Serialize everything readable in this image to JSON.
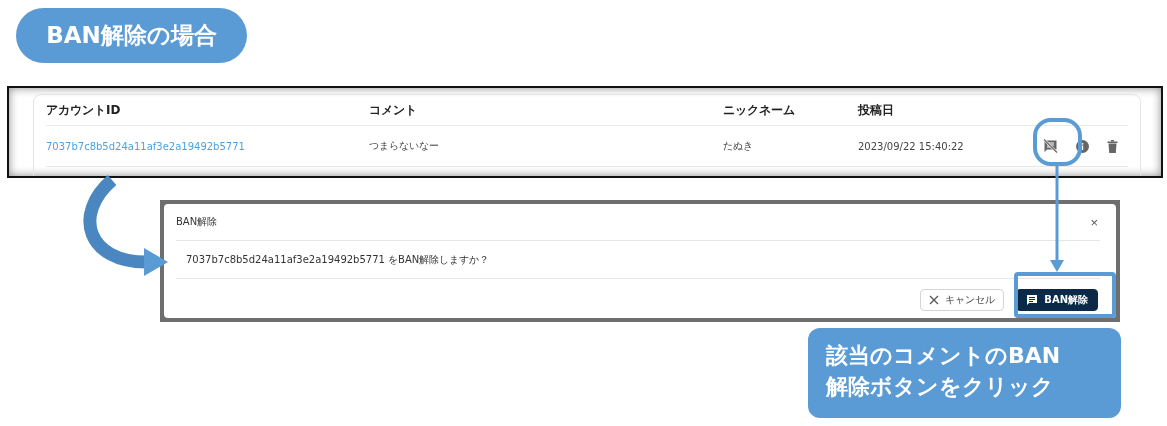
{
  "title_badge": "BAN解除の場合",
  "table": {
    "columns": [
      "アカウントID",
      "コメント",
      "ニックネーム",
      "投稿日"
    ],
    "rows": [
      {
        "account_id": "7037b7c8b5d24a11af3e2a19492b5771",
        "comment": "つまらないなー",
        "nickname": "たぬき",
        "posted": "2023/09/22 15:40:22"
      }
    ]
  },
  "dialog": {
    "title": "BAN解除",
    "close": "×",
    "message": "7037b7c8b5d24a11af3e2a19492b5771 をBAN解除しますか？",
    "buttons": [
      {
        "label": "キャンセル",
        "kind": "cancel"
      },
      {
        "label": "BAN解除",
        "kind": "primary"
      }
    ]
  },
  "callout": "該当のコメントのBAN\n解除ボタンをクリック"
}
